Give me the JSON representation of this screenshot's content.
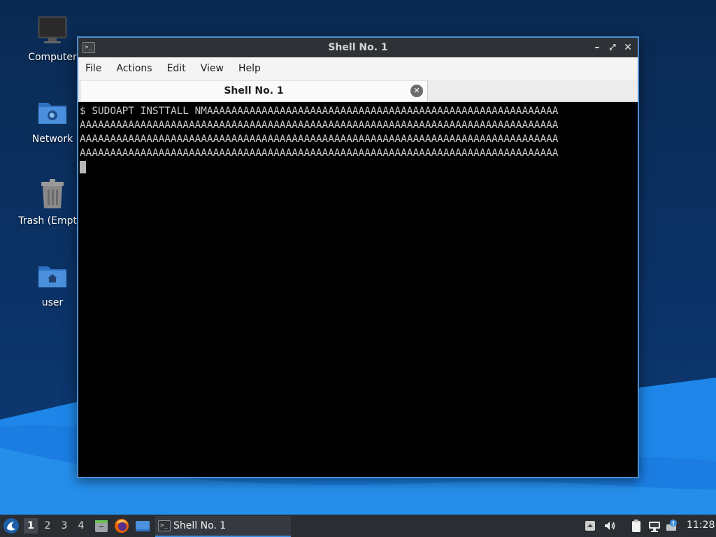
{
  "colors": {
    "accent": "#3d8fe0",
    "desktop_bg": "#0b3266",
    "terminal_bg": "#000000",
    "terminal_fg": "#c8c8c8",
    "taskbar_bg": "#2a2d31"
  },
  "desktop": {
    "icons": [
      {
        "label": "Computer",
        "icon": "monitor-icon"
      },
      {
        "label": "Network",
        "icon": "network-folder-icon"
      },
      {
        "label": "Trash (Empty)",
        "icon": "trash-icon"
      },
      {
        "label": "user",
        "icon": "home-folder-icon"
      }
    ]
  },
  "window": {
    "title": "Shell No. 1",
    "menu": [
      "File",
      "Actions",
      "Edit",
      "View",
      "Help"
    ],
    "tab": {
      "label": "Shell No. 1"
    },
    "terminal": {
      "lines": [
        "$ SUDOAPT INSTTALL NMAAAAAAAAAAAAAAAAAAAAAAAAAAAAAAAAAAAAAAAAAAAAAAAAAAAAAAAAAA",
        "AAAAAAAAAAAAAAAAAAAAAAAAAAAAAAAAAAAAAAAAAAAAAAAAAAAAAAAAAAAAAAAAAAAAAAAAAAAAAAA",
        "AAAAAAAAAAAAAAAAAAAAAAAAAAAAAAAAAAAAAAAAAAAAAAAAAAAAAAAAAAAAAAAAAAAAAAAAAAAAAAA",
        "AAAAAAAAAAAAAAAAAAAAAAAAAAAAAAAAAAAAAAAAAAAAAAAAAAAAAAAAAAAAAAAAAAAAAAAAAAAAAAA"
      ]
    }
  },
  "taskbar": {
    "workspaces": [
      "1",
      "2",
      "3",
      "4"
    ],
    "active_workspace": "1",
    "task_label": "Shell No. 1",
    "clock": "11:28"
  }
}
